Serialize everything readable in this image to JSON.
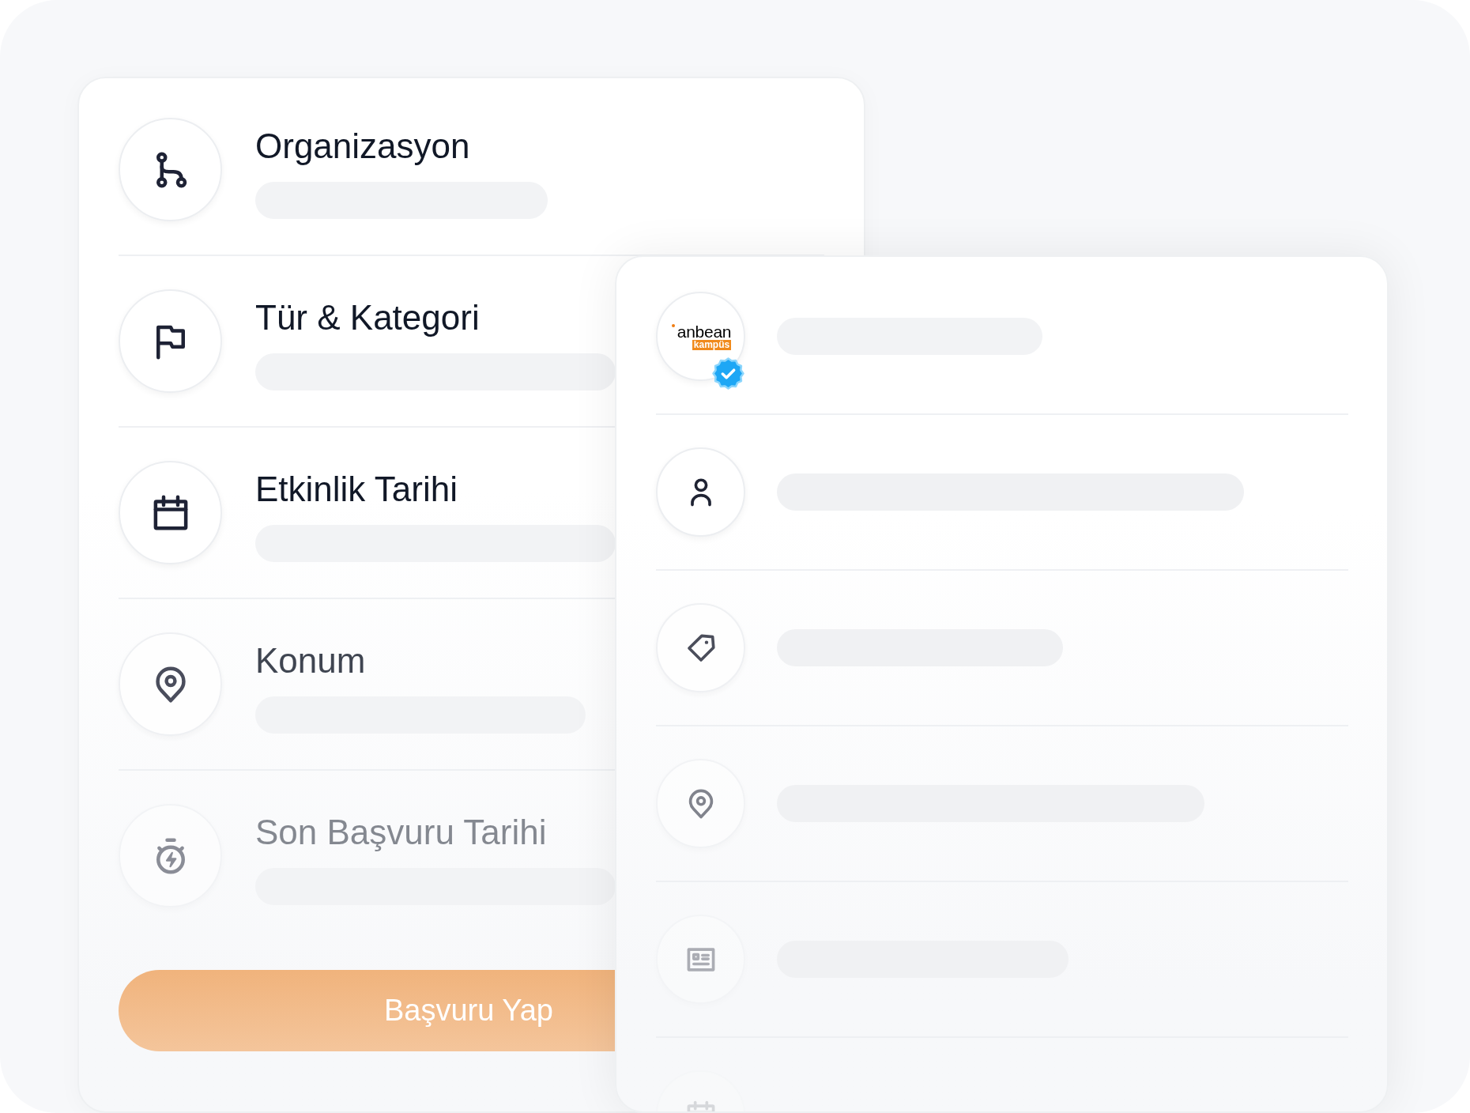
{
  "details_card": {
    "rows": [
      {
        "kind": "branch",
        "title": "Organizasyon"
      },
      {
        "kind": "flag",
        "title": "Tür & Kategori"
      },
      {
        "kind": "calendar",
        "title": "Etkinlik Tarihi"
      },
      {
        "kind": "pin",
        "title": "Konum"
      },
      {
        "kind": "stopwatch",
        "title": "Son Başvuru Tarihi"
      }
    ],
    "apply_button": {
      "label": "Başvuru Yap"
    }
  },
  "profile_card": {
    "logo": {
      "name": "anbean",
      "tagline": "kampüs",
      "verified": true
    },
    "rows": [
      {
        "kind": "person"
      },
      {
        "kind": "tag"
      },
      {
        "kind": "pin"
      },
      {
        "kind": "newspaper"
      },
      {
        "kind": "calendar"
      }
    ]
  }
}
